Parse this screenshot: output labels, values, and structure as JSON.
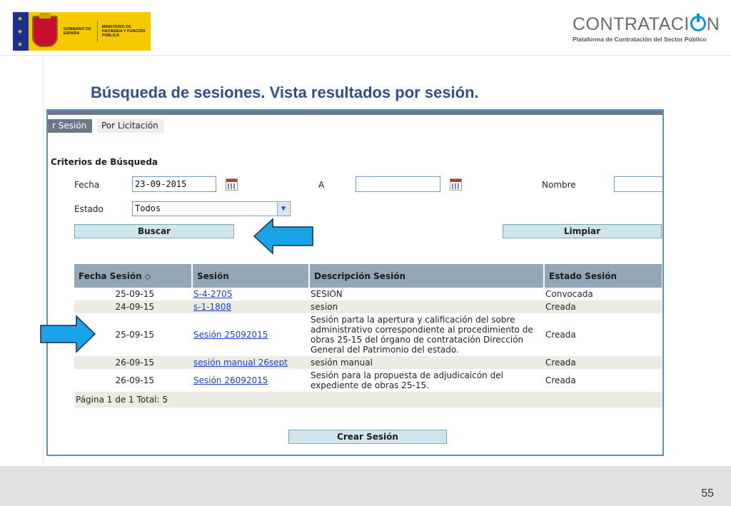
{
  "header": {
    "gov_text_1": "GOBIERNO DE ESPAÑA",
    "gov_text_2": "MINISTERIO DE HACIENDA Y FUNCIÓN PÚBLICA",
    "brand_title_a": "CONTRATACI",
    "brand_title_b": "N",
    "brand_subtitle": "Plataforma de Contratación del Sector Público"
  },
  "slide": {
    "title": "Búsqueda de sesiones. Vista resultados por sesión.",
    "page_number": "55"
  },
  "tabs": [
    {
      "label": "r Sesión",
      "active": true
    },
    {
      "label": "Por Licitación",
      "active": false
    }
  ],
  "criteria": {
    "title": "Criterios de Búsqueda",
    "fecha_label": "Fecha",
    "fecha_value": "23-09-2015",
    "a_label": "A",
    "a_value": "",
    "nombre_label": "Nombre",
    "nombre_value": "",
    "estado_label": "Estado",
    "estado_value": "Todos"
  },
  "buttons": {
    "buscar": "Buscar",
    "limpiar": "Limpiar",
    "crear_sesion": "Crear Sesión"
  },
  "table": {
    "columns": [
      "Fecha Sesión",
      "Sesión",
      "Descripción Sesión",
      "Estado Sesión"
    ],
    "rows": [
      {
        "fecha": "25-09-15",
        "sesion": "S-4-2705",
        "descripcion": "SESION",
        "estado": "Convocada"
      },
      {
        "fecha": "24-09-15",
        "sesion": "s-1-1808",
        "descripcion": "sesion",
        "estado": "Creada"
      },
      {
        "fecha": "25-09-15",
        "sesion": "Sesión 25092015",
        "descripcion": "Sesión parta la apertura y calificación del sobre administrativo correspondiente al procedimiento de obras 25-15 del órgano de contratación Dirección General del Patrimonio del estado.",
        "estado": "Creada"
      },
      {
        "fecha": "26-09-15",
        "sesion": "sesión manual 26sept",
        "descripcion": "sesión manual",
        "estado": "Creada"
      },
      {
        "fecha": "26-09-15",
        "sesion": "Sesión 26092015",
        "descripcion": "Sesión para la propuesta de adjudicaicón del expediente de obras 25-15.",
        "estado": "Creada"
      }
    ],
    "footer": "Página 1 de 1 Total: 5"
  },
  "icons": {
    "sort": "sort-icon",
    "calendar": "calendar-icon",
    "dropdown": "chevron-down-icon",
    "arrow_left": "arrow-left-icon",
    "arrow_right": "arrow-right-icon"
  },
  "colors": {
    "title": "#2e4f8a",
    "frame_border": "#5a8fc4",
    "arrow": "#1aa3e8",
    "link": "#1a3fcc",
    "table_header": "#95a7b6",
    "row_alt": "#ecece2",
    "button": "#cfe7ec"
  }
}
